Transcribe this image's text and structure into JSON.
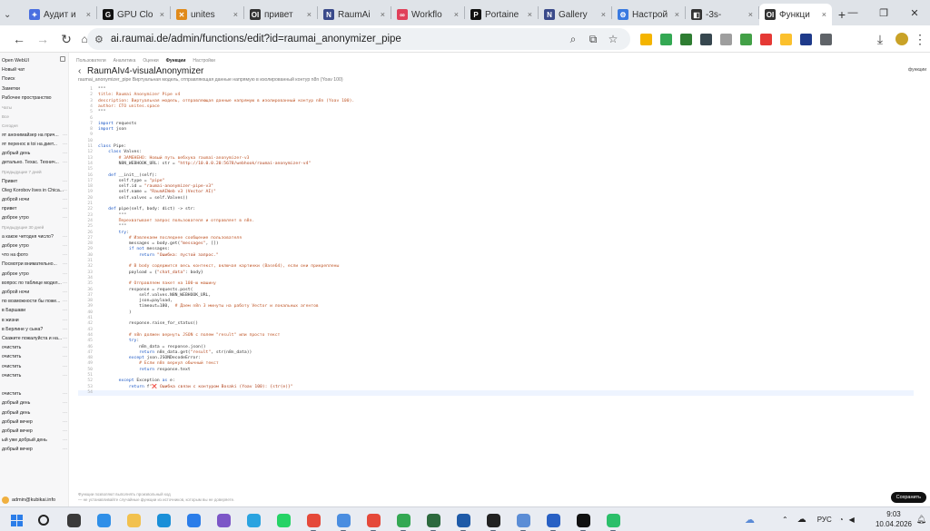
{
  "browser": {
    "tabs": [
      {
        "title": "Аудит и",
        "color": "#4a6fe0",
        "icon": "sparkle-icon",
        "glyph": "✦"
      },
      {
        "title": "GPU Clo",
        "color": "#111111",
        "icon": "gpu-icon",
        "glyph": "G"
      },
      {
        "title": "unites",
        "color": "#e08a1a",
        "icon": "x-logo-icon",
        "glyph": "✕"
      },
      {
        "title": "привет",
        "color": "#333333",
        "icon": "openwebui-icon",
        "glyph": "OI"
      },
      {
        "title": "RaumAi",
        "color": "#3a4a8a",
        "icon": "notion-icon",
        "glyph": "N"
      },
      {
        "title": "Workflo",
        "color": "#e0405a",
        "icon": "n8n-icon",
        "glyph": "∞"
      },
      {
        "title": "Portaine",
        "color": "#111111",
        "icon": "portainer-icon",
        "glyph": "P"
      },
      {
        "title": "Gallery",
        "color": "#3a4a8a",
        "icon": "notion-icon",
        "glyph": "N"
      },
      {
        "title": "Настрой",
        "color": "#3a7ae0",
        "icon": "settings-icon",
        "glyph": "⚙"
      },
      {
        "title": "-3s-",
        "color": "#333333",
        "icon": "tab-icon",
        "glyph": "◧"
      },
      {
        "title": "Функци",
        "color": "#333333",
        "icon": "openwebui-icon",
        "glyph": "OI"
      }
    ],
    "active_tab_index": 10,
    "url": "ai.raumai.de/admin/functions/edit?id=raumai_anonymizer_pipe"
  },
  "extensions": [
    {
      "name": "ext-yellow",
      "color": "#f4b400"
    },
    {
      "name": "ext-drive",
      "color": "#34a853"
    },
    {
      "name": "ext-grid",
      "color": "#2e7d32"
    },
    {
      "name": "ext-s",
      "color": "#37474f"
    },
    {
      "name": "ext-camera",
      "color": "#9e9e9e"
    },
    {
      "name": "ext-green",
      "color": "#43a047"
    },
    {
      "name": "ext-red",
      "color": "#e53935"
    },
    {
      "name": "ext-bolt",
      "color": "#fbc02d"
    },
    {
      "name": "ext-pen",
      "color": "#1e3a8a"
    },
    {
      "name": "ext-puzzle",
      "color": "#5f6368"
    }
  ],
  "sidebar": {
    "items": [
      {
        "label": "Open WebUI",
        "kind": "item"
      },
      {
        "label": "Новый чат",
        "kind": "item"
      },
      {
        "label": "Поиск",
        "kind": "item"
      },
      {
        "label": "Заметки",
        "kind": "item"
      },
      {
        "label": "Рабочее пространство",
        "kind": "item"
      },
      {
        "label": "Чаты",
        "kind": "sec"
      },
      {
        "label": "Все",
        "kind": "sec"
      },
      {
        "label": "Сегодня",
        "kind": "sec"
      },
      {
        "label": "ят анонимайзер на прич...",
        "kind": "item"
      },
      {
        "label": "ят перенос в toi на диет...",
        "kind": "item"
      },
      {
        "label": "добрый день",
        "kind": "item"
      },
      {
        "label": "детально. Техас. Технич...",
        "kind": "item"
      },
      {
        "label": "Предыдущие 7 дней",
        "kind": "sec"
      },
      {
        "label": "Привет",
        "kind": "item"
      },
      {
        "label": "Oleg Korobov lives in Chica...",
        "kind": "item"
      },
      {
        "label": "доброй ночи",
        "kind": "item"
      },
      {
        "label": "привет",
        "kind": "item"
      },
      {
        "label": "доброе утро",
        "kind": "item"
      },
      {
        "label": "Предыдущие 30 дней",
        "kind": "sec"
      },
      {
        "label": "а какое четодня число?",
        "kind": "item"
      },
      {
        "label": "доброе утро",
        "kind": "item"
      },
      {
        "label": "что на фото",
        "kind": "item"
      },
      {
        "label": "Посмотри внимательно...",
        "kind": "item"
      },
      {
        "label": "доброе утро",
        "kind": "item"
      },
      {
        "label": "вопрос по таблице модел...",
        "kind": "item"
      },
      {
        "label": "доброй ночи",
        "kind": "item"
      },
      {
        "label": "по возможности бы поже...",
        "kind": "item"
      },
      {
        "label": "в Баршави",
        "kind": "item"
      },
      {
        "label": "в жизни",
        "kind": "item"
      },
      {
        "label": "в Берлине у сына?",
        "kind": "item"
      },
      {
        "label": "Скажите пожалуйста и на...",
        "kind": "item"
      },
      {
        "label": "очистить",
        "kind": "item"
      },
      {
        "label": "очистить",
        "kind": "item"
      },
      {
        "label": "очистить",
        "kind": "item"
      },
      {
        "label": "очистить",
        "kind": "item"
      },
      {
        "label": "",
        "kind": "sec"
      },
      {
        "label": "очистить",
        "kind": "item"
      },
      {
        "label": "добрый день",
        "kind": "item"
      },
      {
        "label": "добрый день",
        "kind": "item"
      },
      {
        "label": "добрый вечер",
        "kind": "item"
      },
      {
        "label": "добрый вечер",
        "kind": "item"
      },
      {
        "label": "ый уже добрый день",
        "kind": "item"
      },
      {
        "label": "добрый вечер",
        "kind": "item"
      }
    ],
    "user": "admin@kubikai.info"
  },
  "editor": {
    "breadcrumb": [
      "Пользователи",
      "Аналитика",
      "Оценки",
      "Функции",
      "Настройки"
    ],
    "active_crumb_index": 3,
    "title": "RaumAIv4-visualAnonymizer",
    "description": "raumai_anonymizer_pipe   Виртуальная модель, отправляющая данные напрямую в изолированный контур n8n (Yoav 100)",
    "right_label": "функции",
    "save_label": "Сохранить",
    "footer_line1": "Функции позволяют выполнять произвольный код",
    "footer_line2": "— не устанавливайте случайные функции из источников, которым вы не доверяете.",
    "lines": [
      [
        [
          "t",
          "\"\"\""
        ]
      ],
      [
        [
          "c",
          "title: Raumai Anonymizer Pipe v4"
        ]
      ],
      [
        [
          "c",
          "description: Виртуальная модель, отправляющая данные напрямую в изолированный контур n8n (Yoav 100)."
        ]
      ],
      [
        [
          "c",
          "author: CTO unites.space"
        ]
      ],
      [
        [
          "t",
          "\"\"\""
        ]
      ],
      [
        [
          "t",
          ""
        ]
      ],
      [
        [
          "k",
          "import"
        ],
        [
          "t",
          " requests"
        ]
      ],
      [
        [
          "k",
          "import"
        ],
        [
          "t",
          " json"
        ]
      ],
      [
        [
          "t",
          ""
        ]
      ],
      [
        [
          "t",
          ""
        ]
      ],
      [
        [
          "k",
          "class"
        ],
        [
          "t",
          " Pipe:"
        ]
      ],
      [
        [
          "t",
          "    "
        ],
        [
          "k",
          "class"
        ],
        [
          "t",
          " Valves:"
        ]
      ],
      [
        [
          "t",
          "        "
        ],
        [
          "c",
          "# ЗАМЕНЕНО: Новый путь вебхука raumai-anonymizer-v3"
        ]
      ],
      [
        [
          "t",
          "        N8N_WEBHOOK_URL: str = "
        ],
        [
          "s",
          "\"http://10.0.0.20:5678/webhook/raumai-anonymizer-v4\""
        ]
      ],
      [
        [
          "t",
          ""
        ]
      ],
      [
        [
          "t",
          "    "
        ],
        [
          "k",
          "def"
        ],
        [
          "t",
          " __init__(self):"
        ]
      ],
      [
        [
          "t",
          "        self.type = "
        ],
        [
          "s",
          "\"pipe\""
        ]
      ],
      [
        [
          "t",
          "        self.id = "
        ],
        [
          "s",
          "\"raumai-anonymizer-pipe-v3\""
        ]
      ],
      [
        [
          "t",
          "        self.name = "
        ],
        [
          "s",
          "\"RaumAIWeb v3 (Vector AI)\""
        ]
      ],
      [
        [
          "t",
          "        self.valves = self.Valves()"
        ]
      ],
      [
        [
          "t",
          ""
        ]
      ],
      [
        [
          "t",
          "    "
        ],
        [
          "k",
          "def"
        ],
        [
          "t",
          " pipe(self, body: dict) -> str:"
        ]
      ],
      [
        [
          "t",
          "        \"\"\""
        ]
      ],
      [
        [
          "c",
          "        Перехватывает запрос пользователя и отправляет в n8n."
        ]
      ],
      [
        [
          "t",
          "        \"\"\""
        ]
      ],
      [
        [
          "t",
          "        "
        ],
        [
          "k",
          "try"
        ],
        [
          "t",
          ":"
        ]
      ],
      [
        [
          "t",
          "            "
        ],
        [
          "c",
          "# Извлекаем последнее сообщение пользователя"
        ]
      ],
      [
        [
          "t",
          "            messages = body.get("
        ],
        [
          "s",
          "\"messages\""
        ],
        [
          "t",
          ", [])"
        ]
      ],
      [
        [
          "t",
          "            "
        ],
        [
          "k",
          "if not"
        ],
        [
          "t",
          " messages:"
        ]
      ],
      [
        [
          "t",
          "                "
        ],
        [
          "k",
          "return"
        ],
        [
          "t",
          " "
        ],
        [
          "s",
          "\"Ошибка: пустой запрос.\""
        ]
      ],
      [
        [
          "t",
          ""
        ]
      ],
      [
        [
          "t",
          "            "
        ],
        [
          "c",
          "# В body содержится весь контекст, включая картинки (Base64), если они прикреплены"
        ]
      ],
      [
        [
          "t",
          "            payload = {"
        ],
        [
          "s",
          "\"chat_data\""
        ],
        [
          "t",
          ": body}"
        ]
      ],
      [
        [
          "t",
          ""
        ]
      ],
      [
        [
          "t",
          "            "
        ],
        [
          "c",
          "# Отправляем пакет на 100-ю машину"
        ]
      ],
      [
        [
          "t",
          "            response = requests.post("
        ]
      ],
      [
        [
          "t",
          "                self.valves.N8N_WEBHOOK_URL,"
        ]
      ],
      [
        [
          "t",
          "                json=payload,"
        ]
      ],
      [
        [
          "t",
          "                timeout=180,  "
        ],
        [
          "c",
          "# Даем n8n 3 минуты на работу Vector и локальных агентов"
        ]
      ],
      [
        [
          "t",
          "            )"
        ]
      ],
      [
        [
          "t",
          ""
        ]
      ],
      [
        [
          "t",
          "            response.raise_for_status()"
        ]
      ],
      [
        [
          "t",
          ""
        ]
      ],
      [
        [
          "t",
          "            "
        ],
        [
          "c",
          "# n8n должен вернуть JSON с полем \"result\" или просто текст"
        ]
      ],
      [
        [
          "t",
          "            "
        ],
        [
          "k",
          "try"
        ],
        [
          "t",
          ":"
        ]
      ],
      [
        [
          "t",
          "                n8n_data = response.json()"
        ]
      ],
      [
        [
          "t",
          "                "
        ],
        [
          "k",
          "return"
        ],
        [
          "t",
          " n8n_data.get("
        ],
        [
          "s",
          "\"result\""
        ],
        [
          "t",
          ", str(n8n_data))"
        ]
      ],
      [
        [
          "t",
          "            "
        ],
        [
          "k",
          "except"
        ],
        [
          "t",
          " json.JSONDecodeError:"
        ]
      ],
      [
        [
          "t",
          "                "
        ],
        [
          "c",
          "# Если n8n вернул обычный текст"
        ]
      ],
      [
        [
          "t",
          "                "
        ],
        [
          "k",
          "return"
        ],
        [
          "t",
          " response.text"
        ]
      ],
      [
        [
          "t",
          ""
        ]
      ],
      [
        [
          "t",
          "        "
        ],
        [
          "k",
          "except"
        ],
        [
          "t",
          " Exception "
        ],
        [
          "k",
          "as"
        ],
        [
          "t",
          " e:"
        ]
      ],
      [
        [
          "t",
          "            "
        ],
        [
          "k",
          "return"
        ],
        [
          "t",
          " f"
        ],
        [
          "s",
          "\"❌ Ошибка связи с контуром Bosaki (Yoav 100): {str(e)}\""
        ]
      ],
      [
        [
          "t",
          ""
        ]
      ]
    ],
    "current_line": 54
  },
  "taskbar": {
    "icons": [
      {
        "name": "search-icon",
        "color": "#222222"
      },
      {
        "name": "task-view-icon",
        "color": "#3a3a3a"
      },
      {
        "name": "widgets-icon",
        "color": "#2f8fe8"
      },
      {
        "name": "file-explorer-icon",
        "color": "#f2c14e"
      },
      {
        "name": "edge-icon",
        "color": "#1a8fd8"
      },
      {
        "name": "windows-icon",
        "color": "#2b7de9"
      },
      {
        "name": "viber-icon",
        "color": "#7c56c7"
      },
      {
        "name": "telegram-icon",
        "color": "#2aa3e0"
      },
      {
        "name": "whatsapp-icon",
        "color": "#25d366"
      },
      {
        "name": "chrome-icon",
        "color": "#e5493a"
      },
      {
        "name": "chrome-profile-icon",
        "color": "#4a8de0"
      },
      {
        "name": "chrome-active-icon",
        "color": "#e5493a"
      },
      {
        "name": "chrome-alt-icon",
        "color": "#34a853"
      },
      {
        "name": "app-icon",
        "color": "#2d6a3e"
      },
      {
        "name": "remote-icon",
        "color": "#1e5aa8"
      },
      {
        "name": "terminal-icon",
        "color": "#222222"
      },
      {
        "name": "paint-icon",
        "color": "#5b8dd6"
      },
      {
        "name": "photo-icon",
        "color": "#2860c4"
      },
      {
        "name": "chatgpt-icon",
        "color": "#111111"
      },
      {
        "name": "vpn-icon",
        "color": "#2bbf6a"
      }
    ],
    "lang": "РУС",
    "time": "9:03",
    "date": "10.04.2026"
  }
}
